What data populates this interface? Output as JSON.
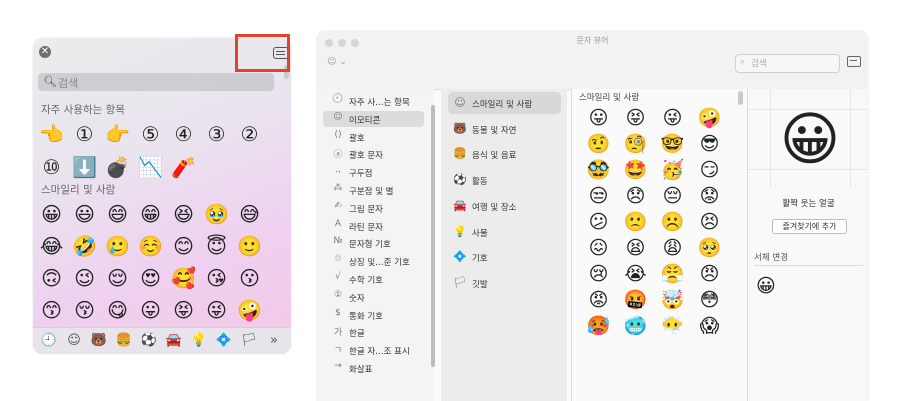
{
  "popup": {
    "search_placeholder": "검색",
    "frequently_used_label": "자주 사용하는 항목",
    "smileys_label": "스마일리 및 사람",
    "frequently_used": [
      "👈",
      "①",
      "👉",
      "⑤",
      "④",
      "③",
      "②",
      "⑩",
      "⬇️",
      "💣",
      "📉",
      "🧨"
    ],
    "smileys": [
      "😀",
      "😃",
      "😄",
      "😁",
      "😆",
      "🥹",
      "😅",
      "😂",
      "🤣",
      "🥲",
      "☺️",
      "😊",
      "😇",
      "🙂",
      "🙃",
      "😉",
      "😌",
      "😍",
      "🥰",
      "😘",
      "😗",
      "😙",
      "😚",
      "😋",
      "😛",
      "😝",
      "😜",
      "🤪",
      "😎",
      "🤩",
      "🥳",
      "😏",
      "😒",
      "😞",
      "🥸",
      "😟"
    ],
    "tabs": [
      "🕘",
      "☺",
      "🐻",
      "🍔",
      "⚽",
      "🚘",
      "💡",
      "💠",
      "🏳",
      "»"
    ]
  },
  "window": {
    "title": "문자 뷰어",
    "search_placeholder": "검색",
    "categories": [
      {
        "icon": "🕘",
        "label": "자주 사…는 항목"
      },
      {
        "icon": "☺",
        "label": "이모티콘"
      },
      {
        "icon": "()",
        "label": "괄호"
      },
      {
        "icon": "ⓐ",
        "label": "괄호 문자"
      },
      {
        "icon": ".,",
        "label": "구두점"
      },
      {
        "icon": "⁂",
        "label": "구분점 및 별"
      },
      {
        "icon": "✍",
        "label": "그림 문자"
      },
      {
        "icon": "A",
        "label": "라틴 문자"
      },
      {
        "icon": "№",
        "label": "문자형 기호"
      },
      {
        "icon": "♲",
        "label": "상징 및…준 기호"
      },
      {
        "icon": "√",
        "label": "수학 기호"
      },
      {
        "icon": "①",
        "label": "숫자"
      },
      {
        "icon": "$",
        "label": "통화 기호"
      },
      {
        "icon": "가",
        "label": "한글"
      },
      {
        "icon": "ㄱ",
        "label": "한글 자…조 표시"
      },
      {
        "icon": "→",
        "label": "화살표"
      }
    ],
    "subcategories": [
      {
        "icon": "☺",
        "label": "스마일리 및 사람"
      },
      {
        "icon": "🐻",
        "label": "동물 및 자연"
      },
      {
        "icon": "🍔",
        "label": "음식 및 음료"
      },
      {
        "icon": "⚽",
        "label": "활동"
      },
      {
        "icon": "🚘",
        "label": "여행 및 장소"
      },
      {
        "icon": "💡",
        "label": "사물"
      },
      {
        "icon": "💠",
        "label": "기호"
      },
      {
        "icon": "🏳",
        "label": "깃발"
      }
    ],
    "grid_header": "스마일리 및 사람",
    "grid": [
      "😛",
      "😝",
      "😜",
      "🤪",
      "🤨",
      "🧐",
      "🤓",
      "😎",
      "🥸",
      "🤩",
      "🥳",
      "😏",
      "😒",
      "😞",
      "😔",
      "😟",
      "😕",
      "🙁",
      "☹️",
      "😣",
      "😖",
      "😫",
      "😩",
      "🥺",
      "😢",
      "😭",
      "😤",
      "😠",
      "😡",
      "🤬",
      "🤯",
      "😳",
      "🥵",
      "🥶",
      "😶‍🌫️",
      "😱"
    ],
    "detail": {
      "emoji": "😀",
      "name": "활짝 웃는 얼굴",
      "favorite_button": "즐겨찾기에 추가",
      "variants_label": "서체 변경",
      "variant": "😀"
    }
  },
  "colors": {
    "highlight": "#e4402b"
  }
}
